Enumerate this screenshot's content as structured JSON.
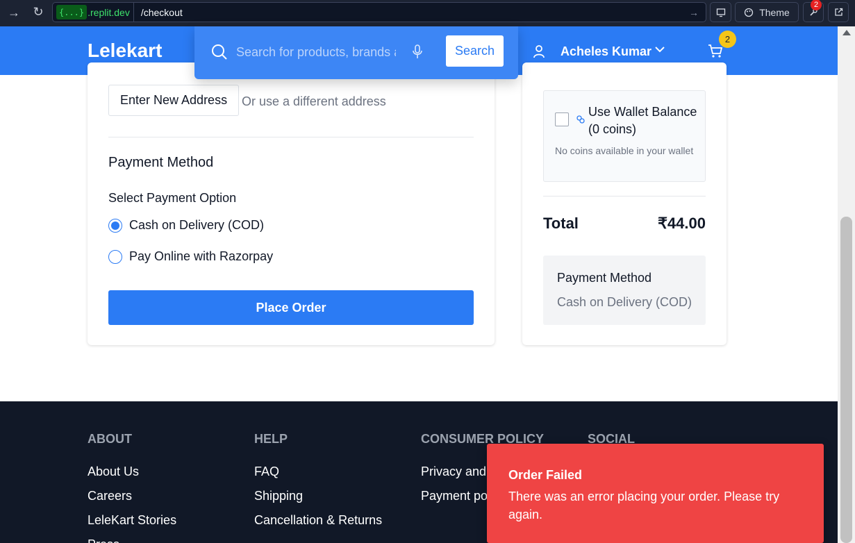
{
  "browser": {
    "url_badge": "{...}",
    "url_domain": ".replit.dev",
    "url_path": "/checkout",
    "theme_label": "Theme",
    "devtools_badge": "2"
  },
  "header": {
    "logo": "Lelekart",
    "search_placeholder": "Search for products, brands and more",
    "search_button": "Search",
    "user_name": "Acheles Kumar",
    "cart_count": "2"
  },
  "address": {
    "new_address_button": "Enter New Address",
    "hint": "Or use a different address"
  },
  "payment": {
    "title": "Payment Method",
    "subtitle": "Select Payment Option",
    "options": [
      {
        "label": "Cash on Delivery (COD)",
        "selected": true
      },
      {
        "label": "Pay Online with Razorpay",
        "selected": false
      }
    ],
    "place_order": "Place Order"
  },
  "summary": {
    "wallet_title": "Use Wallet Balance (0 coins)",
    "wallet_note": "No coins available in your wallet",
    "total_label": "Total",
    "total_value": "₹44.00",
    "payment_method_title": "Payment Method",
    "payment_method_value": "Cash on Delivery (COD)"
  },
  "footer": {
    "columns": [
      {
        "heading": "ABOUT",
        "links": [
          "About Us",
          "Careers",
          "LeleKart Stories",
          "Press"
        ]
      },
      {
        "heading": "HELP",
        "links": [
          "FAQ",
          "Shipping",
          "Cancellation & Returns"
        ]
      },
      {
        "heading": "CONSUMER POLICY",
        "links": [
          "Privacy and Policy",
          "Payment policy"
        ]
      },
      {
        "heading": "SOCIAL",
        "links": []
      }
    ]
  },
  "toast": {
    "title": "Order Failed",
    "message": "There was an error placing your order. Please try again."
  },
  "colors": {
    "brand": "#2b7bf4",
    "toast": "#ef4444",
    "footer": "#111827"
  }
}
